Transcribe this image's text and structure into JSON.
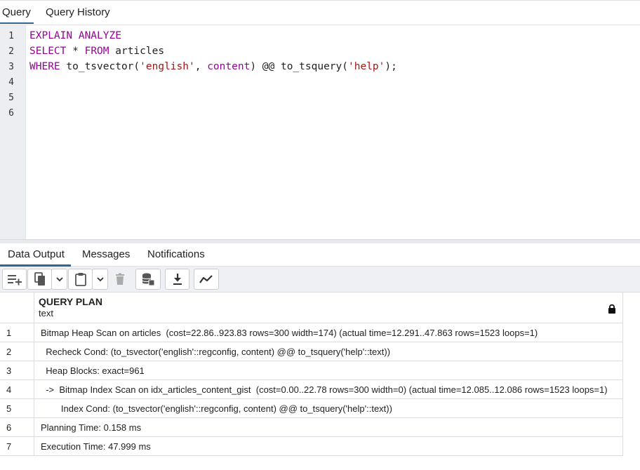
{
  "top_tabs": [
    {
      "label": "Query",
      "active": true
    },
    {
      "label": "Query History",
      "active": false
    }
  ],
  "editor": {
    "line_numbers": [
      "1",
      "2",
      "3",
      "4",
      "5",
      "6"
    ],
    "lines": [
      [
        {
          "t": "EXPLAIN",
          "c": "kw"
        },
        {
          "t": " "
        },
        {
          "t": "ANALYZE",
          "c": "kw"
        }
      ],
      [
        {
          "t": "SELECT",
          "c": "kw"
        },
        {
          "t": " * "
        },
        {
          "t": "FROM",
          "c": "kw"
        },
        {
          "t": " articles"
        }
      ],
      [
        {
          "t": "WHERE",
          "c": "kw"
        },
        {
          "t": " to_tsvector("
        },
        {
          "t": "'english'",
          "c": "str"
        },
        {
          "t": ", "
        },
        {
          "t": "content",
          "c": "kw"
        },
        {
          "t": ") @@ to_tsquery("
        },
        {
          "t": "'help'",
          "c": "str"
        },
        {
          "t": ");"
        }
      ],
      [],
      [],
      []
    ]
  },
  "bottom_tabs": [
    {
      "label": "Data Output",
      "active": true
    },
    {
      "label": "Messages",
      "active": false
    },
    {
      "label": "Notifications",
      "active": false
    }
  ],
  "toolbar": {
    "icons": [
      "add-row-icon",
      "copy-icon",
      "chevron-down-icon",
      "paste-icon",
      "chevron-down-icon",
      "delete-icon",
      "save-data-icon",
      "download-icon",
      "graph-icon"
    ]
  },
  "grid": {
    "column": {
      "title": "QUERY PLAN",
      "type": "text",
      "locked": true
    },
    "rows": [
      {
        "num": "1",
        "text": "Bitmap Heap Scan on articles  (cost=22.86..923.83 rows=300 width=174) (actual time=12.291..47.863 rows=1523 loops=1)"
      },
      {
        "num": "2",
        "text": "  Recheck Cond: (to_tsvector('english'::regconfig, content) @@ to_tsquery('help'::text))"
      },
      {
        "num": "3",
        "text": "  Heap Blocks: exact=961"
      },
      {
        "num": "4",
        "text": "  ->  Bitmap Index Scan on idx_articles_content_gist  (cost=0.00..22.78 rows=300 width=0) (actual time=12.085..12.086 rows=1523 loops=1)"
      },
      {
        "num": "5",
        "text": "        Index Cond: (to_tsvector('english'::regconfig, content) @@ to_tsquery('help'::text))"
      },
      {
        "num": "6",
        "text": "Planning Time: 0.158 ms"
      },
      {
        "num": "7",
        "text": "Execution Time: 47.999 ms"
      }
    ]
  },
  "colors": {
    "accent": "#326690",
    "keyword": "#990099",
    "string": "#a31515"
  }
}
